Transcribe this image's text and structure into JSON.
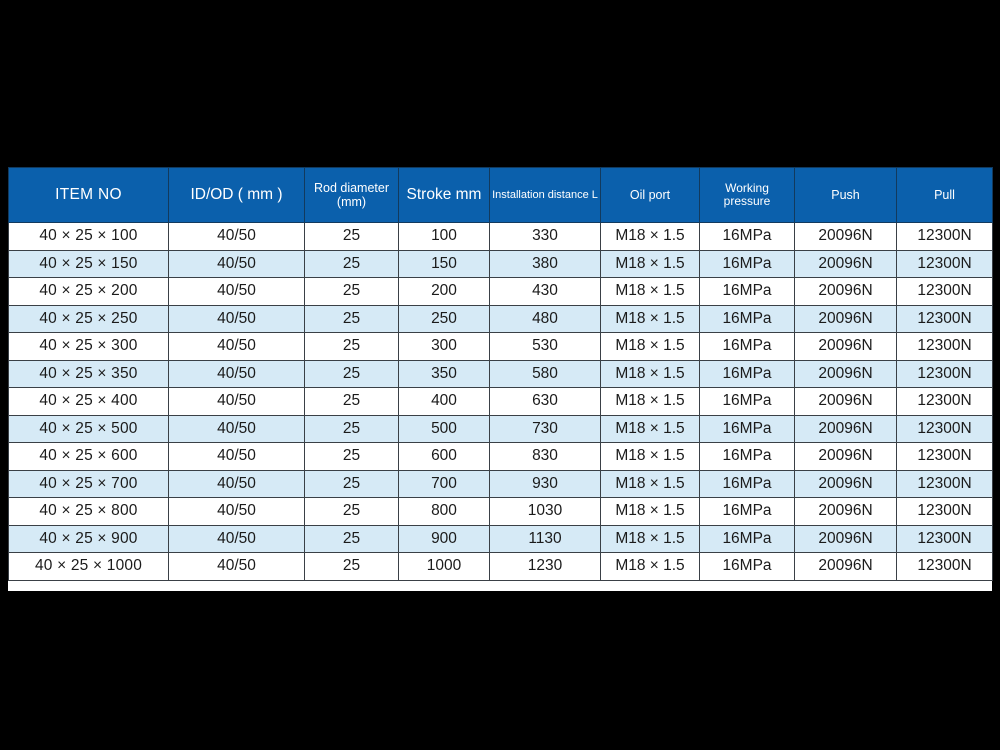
{
  "table": {
    "name": "hydraulic-cylinder-specification-table",
    "colors": {
      "header_background": "#0b60ac",
      "header_text": "#ffffff",
      "row_alt_background": "#d6eaf6",
      "row_background": "#ffffff",
      "grid_line": "#2b3136",
      "page_background": "#000000"
    },
    "headers": [
      "ITEM NO",
      "ID/OD     ( mm )",
      "Rod diameter (mm)",
      "Stroke  mm",
      "Installation distance  L",
      "Oil port",
      "Working pressure",
      "Push",
      "Pull"
    ],
    "header_lines": {
      "rod_diameter_line1": "Rod diameter",
      "rod_diameter_line2": "(mm)"
    },
    "rows": [
      {
        "item": "40 × 25 × 100",
        "id_od": "40/50",
        "rod": "25",
        "stroke": "100",
        "install": "330",
        "oil_port": "M18 × 1.5",
        "pressure": "16MPa",
        "push": "20096N",
        "pull": "12300N"
      },
      {
        "item": "40 × 25 × 150",
        "id_od": "40/50",
        "rod": "25",
        "stroke": "150",
        "install": "380",
        "oil_port": "M18 × 1.5",
        "pressure": "16MPa",
        "push": "20096N",
        "pull": "12300N"
      },
      {
        "item": "40 × 25 × 200",
        "id_od": "40/50",
        "rod": "25",
        "stroke": "200",
        "install": "430",
        "oil_port": "M18 × 1.5",
        "pressure": "16MPa",
        "push": "20096N",
        "pull": "12300N"
      },
      {
        "item": "40 × 25 × 250",
        "id_od": "40/50",
        "rod": "25",
        "stroke": "250",
        "install": "480",
        "oil_port": "M18 × 1.5",
        "pressure": "16MPa",
        "push": "20096N",
        "pull": "12300N"
      },
      {
        "item": "40 × 25 × 300",
        "id_od": "40/50",
        "rod": "25",
        "stroke": "300",
        "install": "530",
        "oil_port": "M18 × 1.5",
        "pressure": "16MPa",
        "push": "20096N",
        "pull": "12300N"
      },
      {
        "item": "40 × 25 × 350",
        "id_od": "40/50",
        "rod": "25",
        "stroke": "350",
        "install": "580",
        "oil_port": "M18 × 1.5",
        "pressure": "16MPa",
        "push": "20096N",
        "pull": "12300N"
      },
      {
        "item": "40 × 25 × 400",
        "id_od": "40/50",
        "rod": "25",
        "stroke": "400",
        "install": "630",
        "oil_port": "M18 × 1.5",
        "pressure": "16MPa",
        "push": "20096N",
        "pull": "12300N"
      },
      {
        "item": "40 × 25 × 500",
        "id_od": "40/50",
        "rod": "25",
        "stroke": "500",
        "install": "730",
        "oil_port": "M18 × 1.5",
        "pressure": "16MPa",
        "push": "20096N",
        "pull": "12300N"
      },
      {
        "item": "40 × 25 × 600",
        "id_od": "40/50",
        "rod": "25",
        "stroke": "600",
        "install": "830",
        "oil_port": "M18 × 1.5",
        "pressure": "16MPa",
        "push": "20096N",
        "pull": "12300N"
      },
      {
        "item": "40 × 25 × 700",
        "id_od": "40/50",
        "rod": "25",
        "stroke": "700",
        "install": "930",
        "oil_port": "M18 × 1.5",
        "pressure": "16MPa",
        "push": "20096N",
        "pull": "12300N"
      },
      {
        "item": "40 × 25 × 800",
        "id_od": "40/50",
        "rod": "25",
        "stroke": "800",
        "install": "1030",
        "oil_port": "M18 × 1.5",
        "pressure": "16MPa",
        "push": "20096N",
        "pull": "12300N"
      },
      {
        "item": "40 × 25 × 900",
        "id_od": "40/50",
        "rod": "25",
        "stroke": "900",
        "install": "1130",
        "oil_port": "M18 × 1.5",
        "pressure": "16MPa",
        "push": "20096N",
        "pull": "12300N"
      },
      {
        "item": "40 × 25 × 1000",
        "id_od": "40/50",
        "rod": "25",
        "stroke": "1000",
        "install": "1230",
        "oil_port": "M18 × 1.5",
        "pressure": "16MPa",
        "push": "20096N",
        "pull": "12300N"
      }
    ]
  }
}
